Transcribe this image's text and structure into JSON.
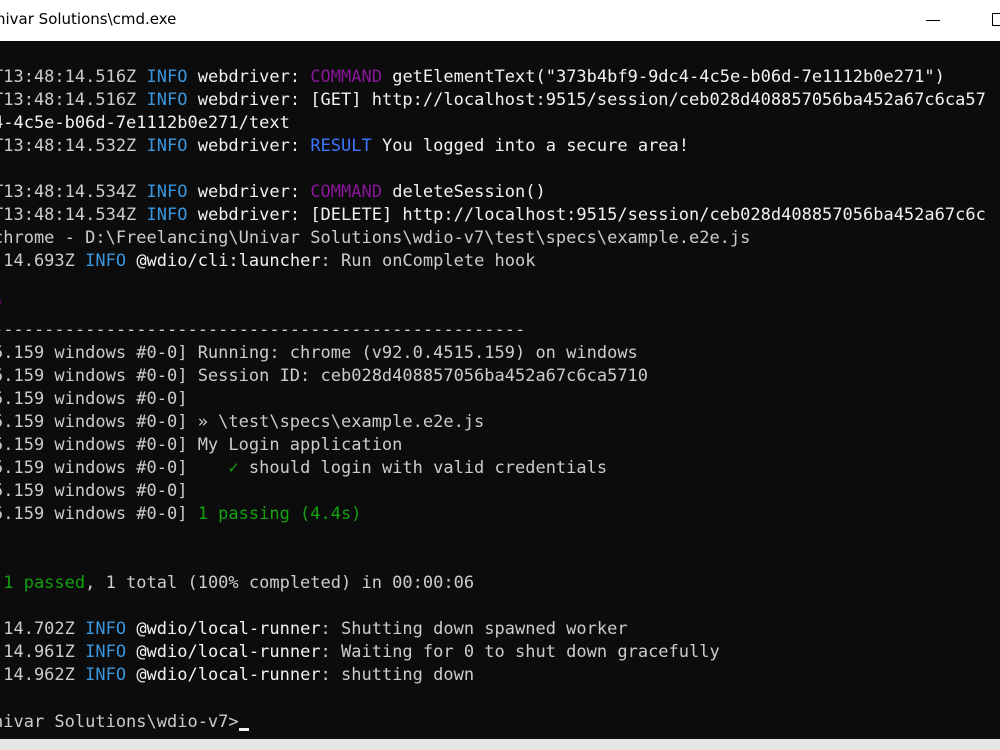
{
  "window": {
    "title": "nivar Solutions\\cmd.exe"
  },
  "terminal": {
    "lines": [
      [
        "T13:48:14.516Z ",
        "INFO",
        " webdriver: ",
        "COMMAND",
        " getElementText(\"373b4bf9-9dc4-4c5e-b06d-7e1112b0e271\")"
      ],
      [
        "T13:48:14.516Z ",
        "INFO",
        " webdriver: ",
        "[GET] http://localhost:9515/session/ceb028d408857056ba452a67c6ca57"
      ],
      [
        "4-4c5e-b06d-7e1112b0e271/text"
      ],
      [
        "T13:48:14.532Z ",
        "INFO",
        " webdriver: ",
        "RESULT",
        " You logged into a secure area!"
      ],
      [
        "T13:48:14.534Z ",
        "INFO",
        " webdriver: ",
        "COMMAND",
        " deleteSession()"
      ],
      [
        "T13:48:14.534Z ",
        "INFO",
        " webdriver: ",
        "[DELETE] http://localhost:9515/session/ceb028d408857056ba452a67c6c"
      ],
      [
        "chrome - D:\\Freelancing\\Univar Solutions\\wdio-v7\\test\\specs\\example.e2e.js"
      ],
      [
        ":14.693Z ",
        "INFO",
        " @wdio/cli:launcher",
        ": Run onComplete hook"
      ],
      [
        "\""
      ],
      [
        "----------------------------------------------------"
      ],
      [
        "5.159 windows #0-0] Running: chrome (v92.0.4515.159) on windows"
      ],
      [
        "5.159 windows #0-0] Session ID: ceb028d408857056ba452a67c6ca5710"
      ],
      [
        "5.159 windows #0-0]"
      ],
      [
        "5.159 windows #0-0] » \\test\\specs\\example.e2e.js"
      ],
      [
        "5.159 windows #0-0] My Login application"
      ],
      [
        "5.159 windows #0-0]    ",
        "✓",
        " should login with valid credentials"
      ],
      [
        "5.159 windows #0-0]"
      ],
      [
        "5.159 windows #0-0] ",
        "1 passing (4.4s)"
      ],
      [
        "'1 passed",
        ", 1 total (100% completed) in 00:00:06"
      ],
      [
        ":14.702Z ",
        "INFO",
        " @wdio/local-runner",
        ": Shutting down spawned worker"
      ],
      [
        ":14.961Z ",
        "INFO",
        " @wdio/local-runner",
        ": Waiting for 0 to shut down gracefully"
      ],
      [
        ":14.962Z ",
        "INFO",
        " @wdio/local-runner",
        ": shutting down"
      ],
      [
        "nivar Solutions\\wdio-v7>"
      ]
    ]
  },
  "colors": {
    "background": "#0c0c0c",
    "text": "#cccccc",
    "info": "#3a96dd",
    "command": "#881798",
    "result": "#3b78ff",
    "pass": "#13a10e"
  }
}
